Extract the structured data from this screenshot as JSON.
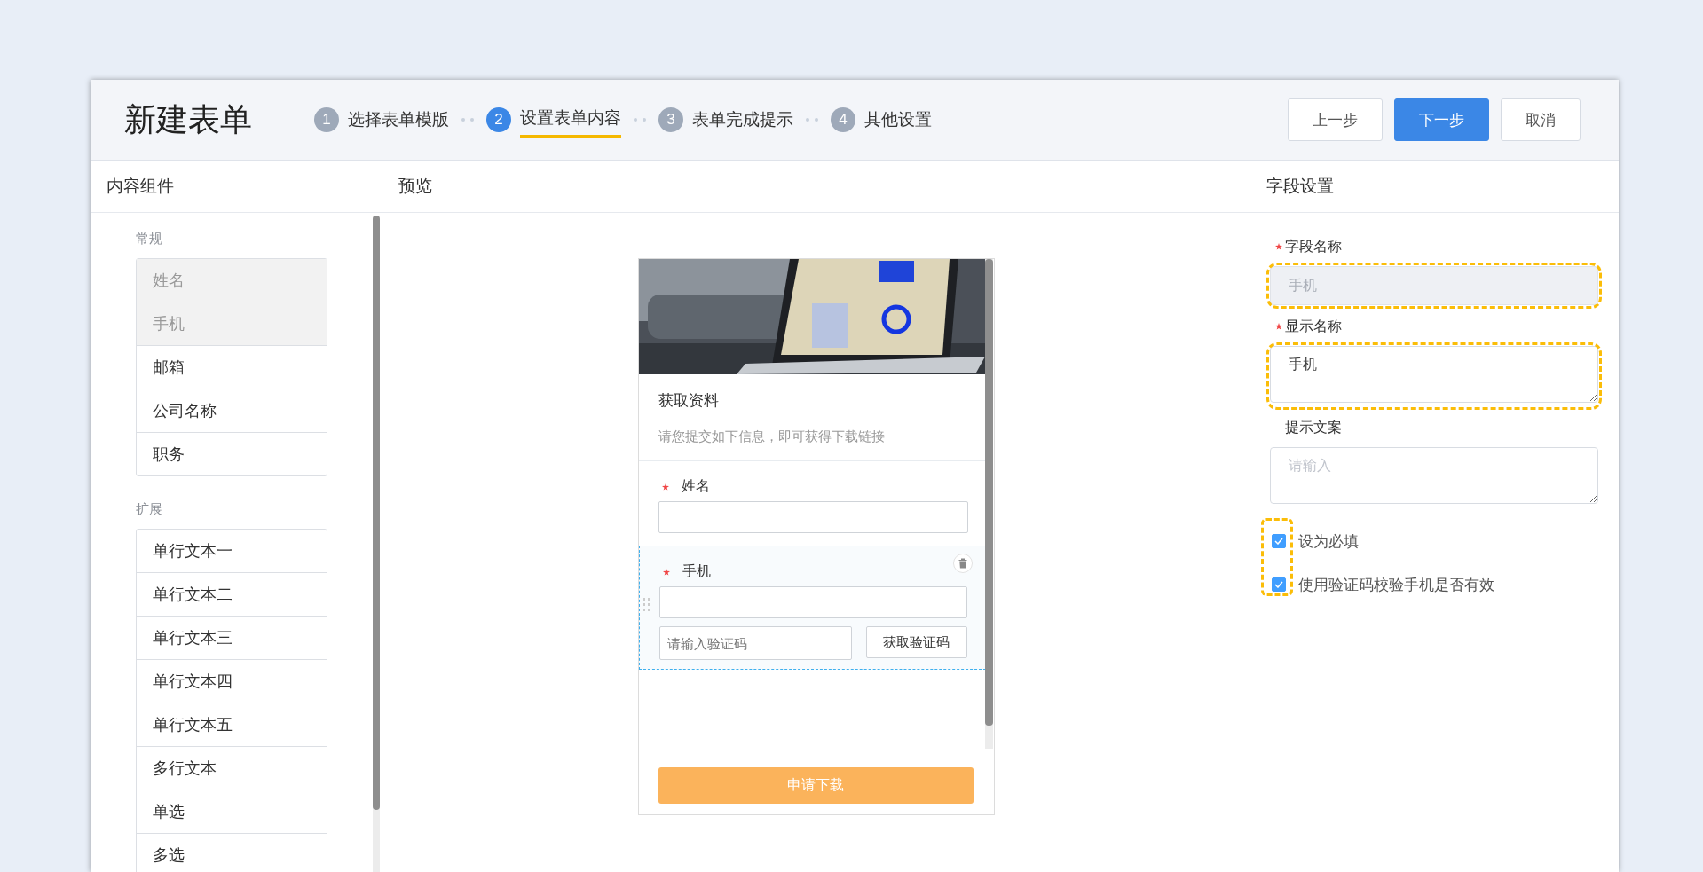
{
  "window": {
    "title": "新建表单"
  },
  "steps": [
    {
      "number": "1",
      "label": "选择表单模版",
      "selected": false
    },
    {
      "number": "2",
      "label": "设置表单内容",
      "selected": true
    },
    {
      "number": "3",
      "label": "表单完成提示",
      "selected": false
    },
    {
      "number": "4",
      "label": "其他设置",
      "selected": false
    }
  ],
  "buttons": [
    {
      "label": "上一步",
      "kind": "default"
    },
    {
      "label": "下一步",
      "kind": "primary"
    },
    {
      "label": "取消",
      "kind": "default"
    }
  ],
  "components_panel": {
    "title": "内容组件",
    "groups": [
      {
        "title": "常规",
        "items": [
          {
            "label": "姓名",
            "disabled": true
          },
          {
            "label": "手机",
            "disabled": true
          },
          {
            "label": "邮箱",
            "disabled": false
          },
          {
            "label": "公司名称",
            "disabled": false
          },
          {
            "label": "职务",
            "disabled": false
          }
        ]
      },
      {
        "title": "扩展",
        "items": [
          {
            "label": "单行文本一",
            "disabled": false
          },
          {
            "label": "单行文本二",
            "disabled": false
          },
          {
            "label": "单行文本三",
            "disabled": false
          },
          {
            "label": "单行文本四",
            "disabled": false
          },
          {
            "label": "单行文本五",
            "disabled": false
          },
          {
            "label": "多行文本",
            "disabled": false
          },
          {
            "label": "单选",
            "disabled": false
          },
          {
            "label": "多选",
            "disabled": false
          }
        ]
      }
    ]
  },
  "preview_panel": {
    "title": "预览",
    "form": {
      "title": "获取资料",
      "subtitle": "请您提交如下信息，即可获得下载链接",
      "fields": [
        {
          "label": "姓名",
          "kind": "text",
          "required": true,
          "selected": false
        },
        {
          "label": "手机",
          "kind": "phone",
          "required": true,
          "selected": true,
          "code_placeholder": "请输入验证码",
          "code_button": "获取验证码"
        }
      ],
      "submit": "申请下载"
    }
  },
  "settings_panel": {
    "title": "字段设置",
    "fields": [
      {
        "label": "字段名称",
        "kind": "input",
        "required": true,
        "disabled": true,
        "highlighted": true,
        "value": "手机"
      },
      {
        "label": "显示名称",
        "kind": "textarea",
        "required": true,
        "disabled": false,
        "highlighted": true,
        "value": "手机"
      },
      {
        "label": "提示文案",
        "kind": "textarea",
        "required": false,
        "disabled": false,
        "highlighted": false,
        "placeholder": "请输入"
      }
    ],
    "checkboxes_highlighted": true,
    "checkboxes": [
      {
        "label": "设为必填",
        "checked": true
      },
      {
        "label": "使用验证码校验手机是否有效",
        "checked": true
      }
    ]
  }
}
